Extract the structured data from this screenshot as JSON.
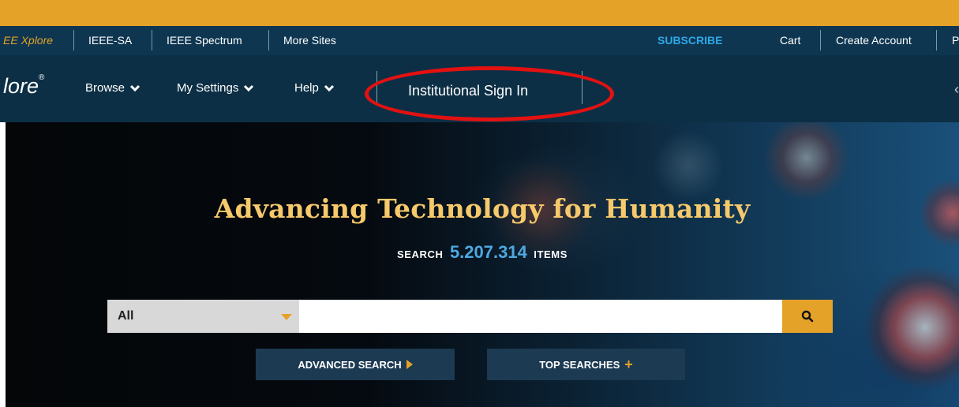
{
  "topbar": {
    "brand": "EE Xplore",
    "links": [
      "IEEE-SA",
      "IEEE Spectrum",
      "More Sites"
    ],
    "subscribe": "SUBSCRIBE",
    "cart": "Cart",
    "create_account": "Create Account",
    "cut_off": "P"
  },
  "navbar": {
    "logo": "lore",
    "logo_mark": "®",
    "menu": [
      {
        "label": "Browse",
        "icon": "chevron-down-icon"
      },
      {
        "label": "My Settings",
        "icon": "chevron-down-icon"
      },
      {
        "label": "Help",
        "icon": "chevron-down-icon"
      }
    ],
    "signin": "Institutional Sign In",
    "signin_highlight_color": "#e31111"
  },
  "hero": {
    "headline": "Advancing Technology for Humanity",
    "stat_prefix": "SEARCH",
    "stat_value": "5.207.314",
    "stat_suffix": "ITEMS",
    "search": {
      "scope_selected": "All",
      "query_value": "",
      "query_placeholder": "",
      "search_icon": "search-icon"
    },
    "advanced_search": "ADVANCED SEARCH",
    "top_searches": "TOP SEARCHES"
  },
  "colors": {
    "accent": "#e5a229",
    "navy": "#0c2f45",
    "headline": "#f6c96b",
    "stat_number": "#4ea8e2",
    "subscribe": "#2fa7e8"
  }
}
